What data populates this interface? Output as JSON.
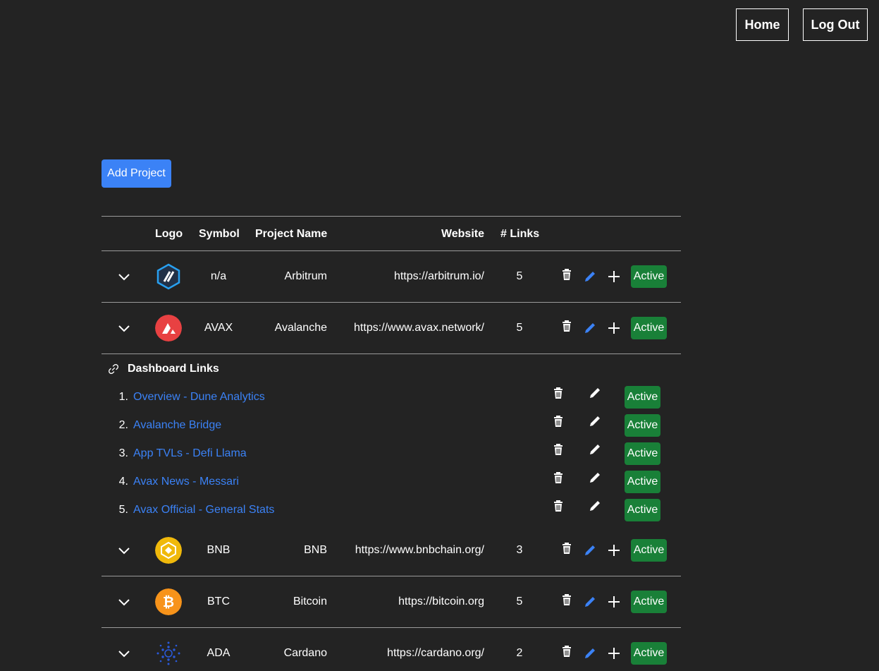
{
  "nav": {
    "home_label": "Home",
    "logout_label": "Log Out"
  },
  "toolbar": {
    "add_project_label": "Add Project"
  },
  "table": {
    "headers": {
      "logo": "Logo",
      "symbol": "Symbol",
      "project_name": "Project Name",
      "website": "Website",
      "links": "# Links"
    },
    "rows": [
      {
        "symbol": "n/a",
        "name": "Arbitrum",
        "website": "https://arbitrum.io/",
        "links": "5",
        "status": "Active",
        "logo_color": "#213147"
      },
      {
        "symbol": "AVAX",
        "name": "Avalanche",
        "website": "https://www.avax.network/",
        "links": "5",
        "status": "Active",
        "logo_color": "#e84142"
      },
      {
        "symbol": "BNB",
        "name": "BNB",
        "website": "https://www.bnbchain.org/",
        "links": "3",
        "status": "Active",
        "logo_color": "#f0b90b"
      },
      {
        "symbol": "BTC",
        "name": "Bitcoin",
        "website": "https://bitcoin.org",
        "links": "5",
        "status": "Active",
        "logo_color": "#f7931a"
      },
      {
        "symbol": "ADA",
        "name": "Cardano",
        "website": "https://cardano.org/",
        "links": "2",
        "status": "Active",
        "logo_color": "#0033ad"
      }
    ]
  },
  "dashboard": {
    "title": "Dashboard Links",
    "links": [
      {
        "num": "1.",
        "label": "Overview - Dune Analytics",
        "status": "Active"
      },
      {
        "num": "2.",
        "label": "Avalanche Bridge",
        "status": "Active"
      },
      {
        "num": "3.",
        "label": "App TVLs - Defi Llama",
        "status": "Active"
      },
      {
        "num": "4.",
        "label": "Avax News - Messari",
        "status": "Active"
      },
      {
        "num": "5.",
        "label": "Avax Official - General Stats",
        "status": "Active"
      }
    ]
  },
  "colors": {
    "background": "#232323",
    "accent": "#3b82f6",
    "active": "#198038",
    "link": "#3b82f6"
  }
}
